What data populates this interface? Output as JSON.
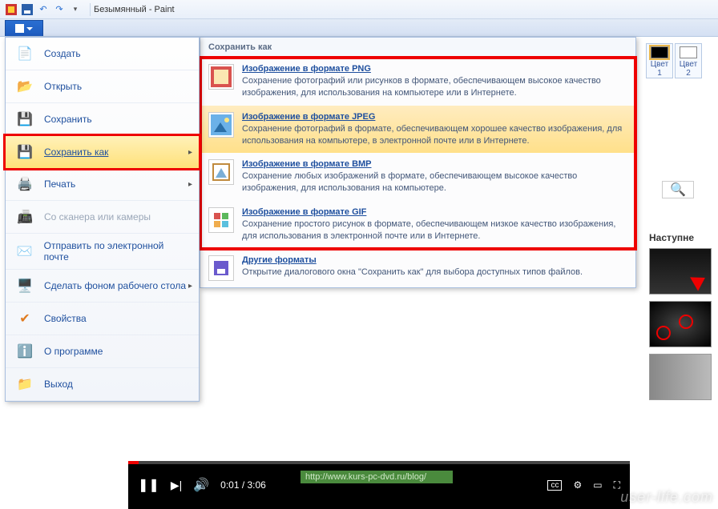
{
  "window": {
    "title": "Безымянный - Paint"
  },
  "colors": {
    "c1": {
      "label": "Цвет\n1",
      "hex": "#000000"
    },
    "c2": {
      "label": "Цвет\n2",
      "hex": "#ffffff"
    }
  },
  "fileMenu": {
    "create": {
      "label": "Создать"
    },
    "open": {
      "label": "Открыть"
    },
    "save": {
      "label": "Сохранить"
    },
    "saveAs": {
      "label": "Сохранить как"
    },
    "print": {
      "label": "Печать"
    },
    "scanner": {
      "label": "Со сканера или камеры"
    },
    "email": {
      "label": "Отправить по электронной почте"
    },
    "wallpaper": {
      "label": "Сделать фоном рабочего стола"
    },
    "props": {
      "label": "Свойства"
    },
    "about": {
      "label": "О программе"
    },
    "exit": {
      "label": "Выход"
    }
  },
  "saveAsPanel": {
    "header": "Сохранить как",
    "png": {
      "title": "Изображение в формате PNG",
      "desc": "Сохранение фотографий или рисунков в формате, обеспечивающем высокое качество изображения, для использования на компьютере или в Интернете."
    },
    "jpeg": {
      "title": "Изображение в формате JPEG",
      "desc": "Сохранение фотографий в формате, обеспечивающем хорошее качество изображения, для использования на компьютере, в электронной почте или в Интернете."
    },
    "bmp": {
      "title": "Изображение в формате BMP",
      "desc": "Сохранение любых изображений в формате, обеспечивающем высокое качество изображения, для использования на компьютере."
    },
    "gif": {
      "title": "Изображение в формате GIF",
      "desc": "Сохранение простого рисунок в формате, обеспечивающем низкое качество изображения, для использования в электронной почте или в Интернете."
    },
    "other": {
      "title": "Другие форматы",
      "desc": "Открытие диалогового окна \"Сохранить как\" для выбора доступных типов файлов."
    }
  },
  "rightCol": {
    "heading": "Наступне"
  },
  "video": {
    "time": "0:01 / 3:06",
    "url": "http://www.kurs-pc-dvd.ru/blog/"
  },
  "watermark": "user-life.com"
}
